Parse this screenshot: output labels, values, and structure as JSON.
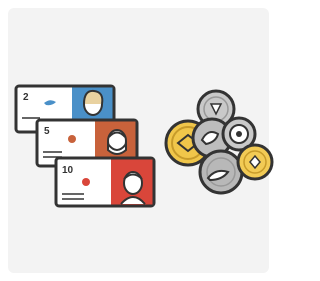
{
  "illustration": {
    "description_icon": "money-illustration-icon",
    "banknotes": [
      {
        "denomination": "2",
        "accent": "#4a90c8",
        "portrait": "woman"
      },
      {
        "denomination": "5",
        "accent": "#c8623b",
        "portrait": "bearded-man"
      },
      {
        "denomination": "10",
        "accent": "#d9463a",
        "portrait": "man"
      }
    ],
    "coins": [
      {
        "metal": "gold",
        "color": "#f0c64a"
      },
      {
        "metal": "silver",
        "color": "#c9c9c9"
      },
      {
        "metal": "silver",
        "color": "#bdbdbd"
      },
      {
        "metal": "silver",
        "color": "#b8b8b8"
      },
      {
        "metal": "gold",
        "color": "#f2cb55"
      }
    ],
    "colors": {
      "card_background": "#f3f3f3",
      "outline": "#333333",
      "note_paper": "#ffffff"
    }
  }
}
